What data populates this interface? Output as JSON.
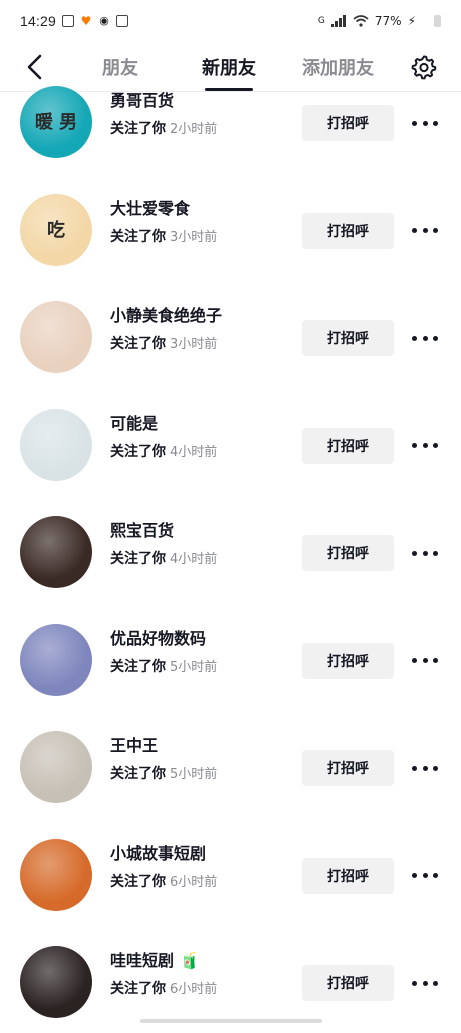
{
  "status_bar": {
    "time": "14:29",
    "network": "G",
    "battery": "77%"
  },
  "nav": {
    "tabs": [
      {
        "label": "朋友",
        "active": false
      },
      {
        "label": "新朋友",
        "active": true
      },
      {
        "label": "添加朋友",
        "active": false
      }
    ]
  },
  "greet_label": "打招呼",
  "followers": [
    {
      "name": "勇哥百货",
      "action": "关注了你",
      "time": "2小时前",
      "avatar_text": "暖 男",
      "avatar_color": "#14a7b6"
    },
    {
      "name": "大壮爱零食",
      "action": "关注了你",
      "time": "3小时前",
      "avatar_text": "吃",
      "avatar_color": "#f3d7a6"
    },
    {
      "name": "小静美食绝绝子",
      "action": "关注了你",
      "time": "3小时前",
      "avatar_text": "",
      "avatar_color": "#e9d1bf"
    },
    {
      "name": "可能是",
      "action": "关注了你",
      "time": "4小时前",
      "avatar_text": "",
      "avatar_color": "#d9e3e6"
    },
    {
      "name": "熙宝百货",
      "action": "关注了你",
      "time": "4小时前",
      "avatar_text": "",
      "avatar_color": "#3a2a25"
    },
    {
      "name": "优品好物数码",
      "action": "关注了你",
      "time": "5小时前",
      "avatar_text": "",
      "avatar_color": "#7e86bd"
    },
    {
      "name": "王中王",
      "action": "关注了你",
      "time": "5小时前",
      "avatar_text": "",
      "avatar_color": "#c7c0b6"
    },
    {
      "name": "小城故事短剧",
      "action": "关注了你",
      "time": "6小时前",
      "avatar_text": "",
      "avatar_color": "#d66a2a"
    },
    {
      "name": "哇哇短剧 🧃",
      "action": "关注了你",
      "time": "6小时前",
      "avatar_text": "",
      "avatar_color": "#2b2222"
    }
  ]
}
